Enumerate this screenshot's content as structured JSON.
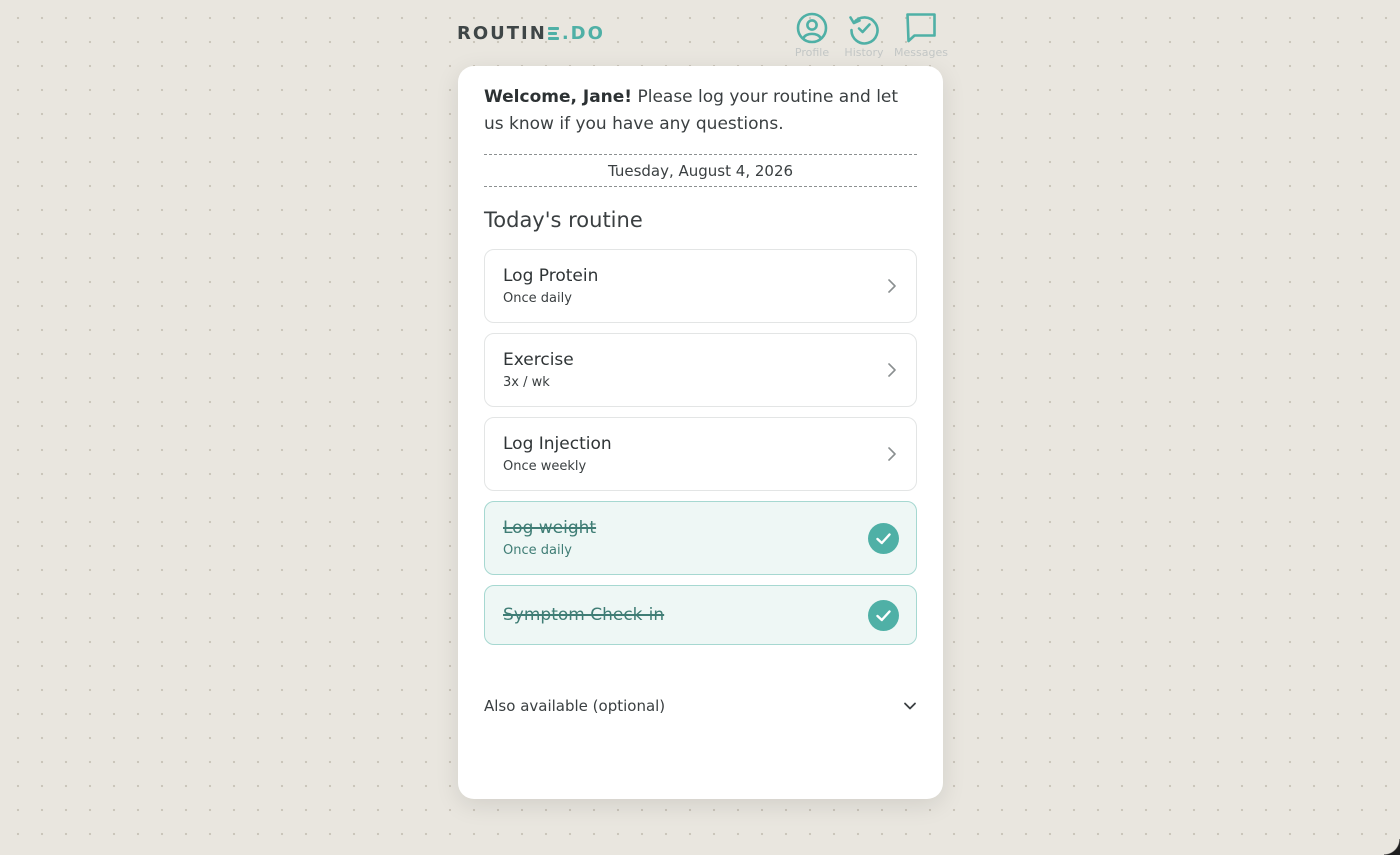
{
  "brand": {
    "part1": "ROUTIN",
    "part2": ".DO",
    "accent_color": "#4fb0a6"
  },
  "nav": [
    {
      "label": "Profile",
      "icon": "profile-icon"
    },
    {
      "label": "History",
      "icon": "history-icon"
    },
    {
      "label": "Messages",
      "icon": "messages-icon"
    }
  ],
  "welcome": {
    "greeting": "Welcome, Jane!",
    "message": " Please log your routine and let us know if you have any questions."
  },
  "date": "Tuesday, August 4, 2026",
  "routine": {
    "title": "Today's routine",
    "tasks": [
      {
        "name": "Log Protein",
        "frequency": "Once daily",
        "status": "pending"
      },
      {
        "name": "Exercise",
        "frequency": "3x / wk",
        "status": "pending"
      },
      {
        "name": "Log Injection",
        "frequency": "Once weekly",
        "status": "pending"
      },
      {
        "name": "Log weight",
        "frequency": "Once daily",
        "status": "done"
      },
      {
        "name": "Symptom Check-in",
        "frequency": "",
        "status": "done"
      }
    ]
  },
  "optional_section": {
    "label": "Also available (optional)"
  }
}
